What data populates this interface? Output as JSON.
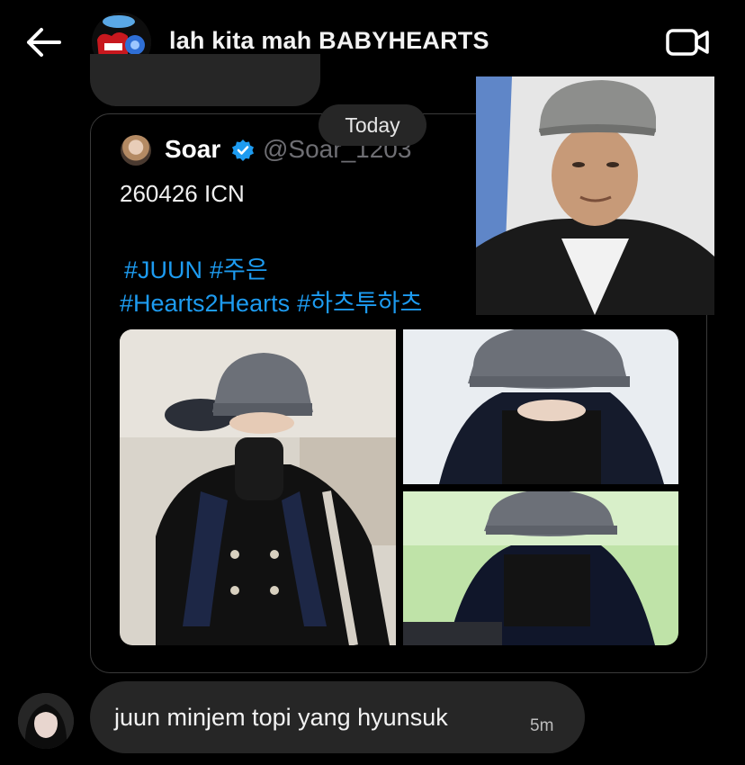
{
  "header": {
    "title": "lah kita mah BABYHEARTS",
    "back_icon": "back-arrow-icon",
    "video_icon": "video-call-icon"
  },
  "date_divider": "Today",
  "tweet": {
    "author_name": "Soar",
    "author_handle": "@Soar_1203",
    "verified": true,
    "text": "260426 ICN",
    "hashtags_line1": [
      "#JUUN",
      "#주은"
    ],
    "hashtags_line2": [
      "#Hearts2Hearts",
      "#하츠투하츠"
    ],
    "photo_count": 3
  },
  "message": {
    "text": "juun minjem topi yang hyunsuk",
    "time": "5m"
  },
  "colors": {
    "background": "#000000",
    "bubble": "#262626",
    "link": "#1d9bf0",
    "verified": "#1d9bf0",
    "muted": "#6e6e73"
  }
}
